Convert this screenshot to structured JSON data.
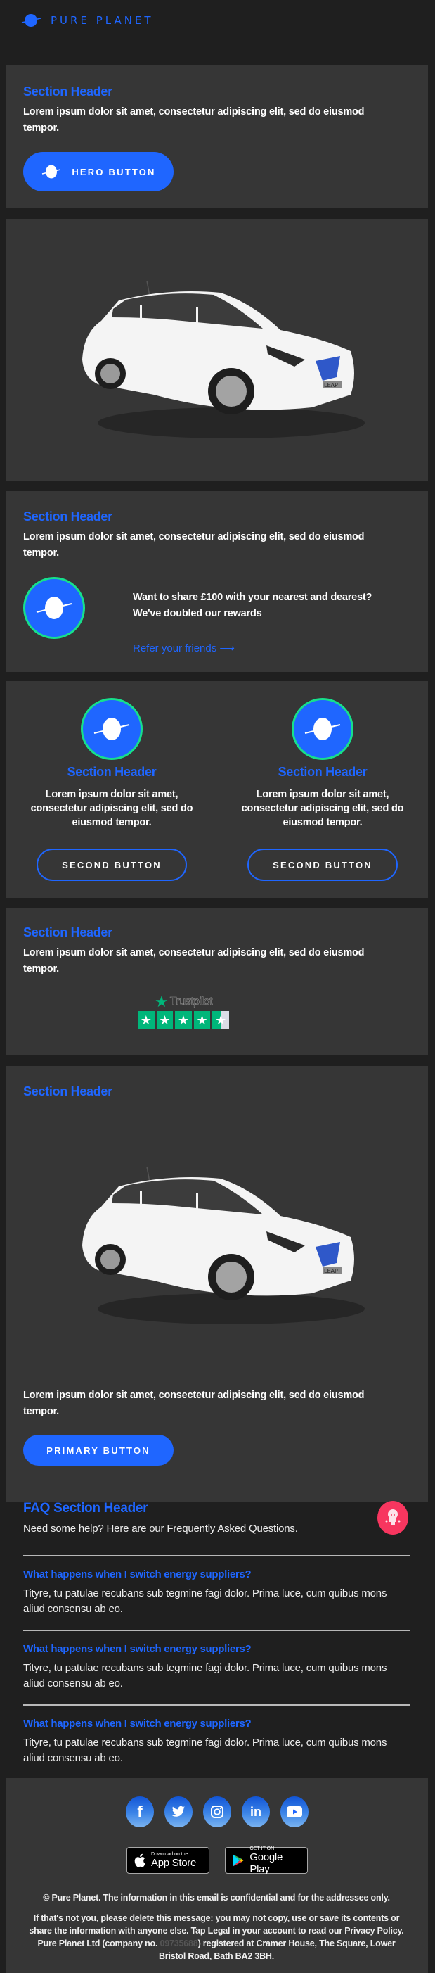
{
  "brand": {
    "name": "PURE PLANET",
    "accent": "#1f66ff",
    "ring": "#16e08c"
  },
  "section1": {
    "header": "Section Header",
    "body": "Lorem ipsum dolor sit amet, consectetur adipiscing elit, sed do eiusmod tempor.",
    "button": "HERO BUTTON"
  },
  "car1": {
    "alt": "White Nissan Leaf",
    "badge": "LEAP"
  },
  "referral": {
    "header": "Section Header",
    "body": "Lorem ipsum dolor sit amet, consectetur adipiscing elit, sed do eiusmod tempor.",
    "promo": "Want to share £100 with your nearest and dearest? We've doubled our rewards",
    "link": "Refer your friends ⟶"
  },
  "columns": [
    {
      "header": "Section Header",
      "body": "Lorem ipsum dolor sit amet, consectetur adipiscing elit, sed do eiusmod tempor.",
      "button": "SECOND BUTTON"
    },
    {
      "header": "Section Header",
      "body": "Lorem ipsum dolor sit amet, consectetur adipiscing elit, sed do eiusmod tempor.",
      "button": "SECOND BUTTON"
    }
  ],
  "trust": {
    "header": "Section Header",
    "body": "Lorem ipsum dolor sit amet, consectetur adipiscing elit, sed do eiusmod tempor.",
    "brand": "Trustpilot",
    "rating": 4.5,
    "max": 5
  },
  "car2": {
    "header": "Section Header",
    "body": "Lorem ipsum dolor sit amet, consectetur adipiscing elit, sed do eiusmod tempor.",
    "button": "PRIMARY BUTTON",
    "badge": "LEAP"
  },
  "faq": {
    "header": "FAQ Section Header",
    "intro": "Need some help? Here are our Frequently Asked Questions.",
    "items": [
      {
        "q": "What happens when I switch energy suppliers?",
        "a": "Tityre, tu patulae recubans sub tegmine fagi dolor. Prima luce, cum quibus mons aliud consensu ab eo."
      },
      {
        "q": "What happens when I switch energy suppliers?",
        "a": "Tityre, tu patulae recubans sub tegmine fagi dolor. Prima luce, cum quibus mons aliud consensu ab eo."
      },
      {
        "q": "What happens when I switch energy suppliers?",
        "a": "Tityre, tu patulae recubans sub tegmine fagi dolor. Prima luce, cum quibus mons aliud consensu ab eo."
      }
    ]
  },
  "footer": {
    "social": [
      "facebook",
      "twitter",
      "instagram",
      "linkedin",
      "youtube"
    ],
    "appstore": {
      "small": "Download on the",
      "big": "App Store"
    },
    "googleplay": {
      "small": "GET IT ON",
      "big": "Google Play"
    },
    "copyright": "© Pure Planet. The information in this email is confidential and for the addressee only.",
    "legal_pre": "If that's not you, please delete this message: you may not copy, use or save its contents or share the information with anyone else. Tap Legal in your account to read our Privacy Policy. Pure Planet Ltd (company no. ",
    "company_no": "09735688",
    "legal_post": ") registered at Cramer House, The Square, Lower Bristol Road, Bath BA2 3BH."
  }
}
